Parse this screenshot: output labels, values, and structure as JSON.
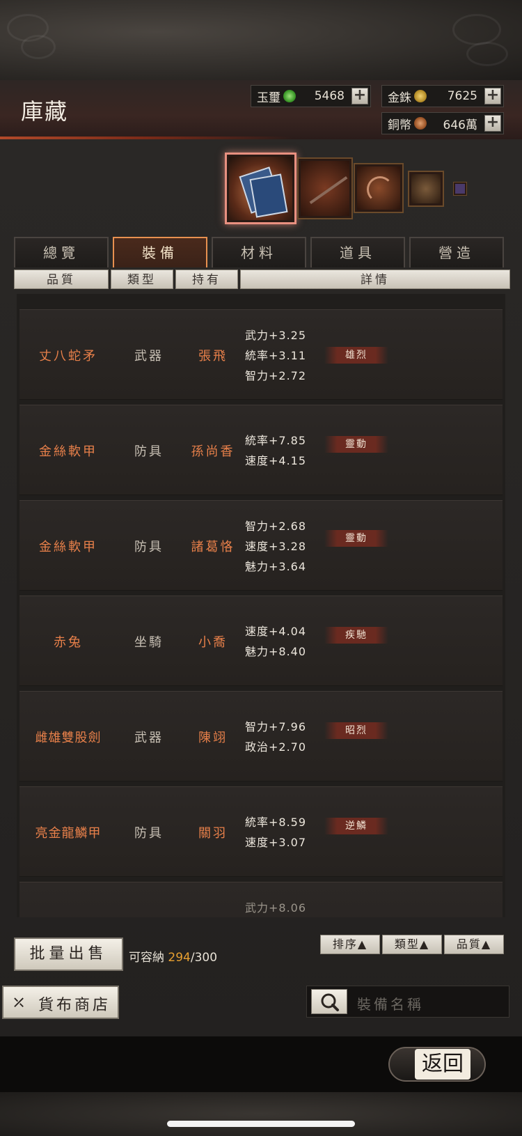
{
  "header": {
    "title": "庫藏",
    "resources": [
      {
        "label": "玉璽",
        "icon": "jade-coin-icon",
        "value": "5468"
      },
      {
        "label": "金銖",
        "icon": "gold-coin-icon",
        "value": "7625"
      },
      {
        "label": "銅幣",
        "icon": "copper-coin-icon",
        "value": "646萬"
      }
    ],
    "plus_label": "+"
  },
  "tabs": [
    {
      "label": "總覽",
      "active": false
    },
    {
      "label": "裝備",
      "active": true
    },
    {
      "label": "材料",
      "active": false
    },
    {
      "label": "道具",
      "active": false
    },
    {
      "label": "營造",
      "active": false
    }
  ],
  "columns": [
    "品質",
    "類型",
    "持有",
    "詳情"
  ],
  "items": [
    {
      "name": "丈八蛇矛",
      "type": "武器",
      "owner": "張飛",
      "stats": [
        "武力+3.25",
        "統率+3.11",
        "智力+2.72"
      ],
      "skill": "雄烈"
    },
    {
      "name": "金絲軟甲",
      "type": "防具",
      "owner": "孫尚香",
      "stats": [
        "統率+7.85",
        "速度+4.15"
      ],
      "skill": "靈動"
    },
    {
      "name": "金絲軟甲",
      "type": "防具",
      "owner": "諸葛恪",
      "stats": [
        "智力+2.68",
        "速度+3.28",
        "魅力+3.64"
      ],
      "skill": "靈動"
    },
    {
      "name": "赤兔",
      "type": "坐騎",
      "owner": "小喬",
      "stats": [
        "速度+4.04",
        "魅力+8.40"
      ],
      "skill": "疾馳"
    },
    {
      "name": "雌雄雙股劍",
      "type": "武器",
      "owner": "陳翊",
      "stats": [
        "智力+7.96",
        "政治+2.70"
      ],
      "skill": "昭烈"
    },
    {
      "name": "亮金龍鱗甲",
      "type": "防具",
      "owner": "關羽",
      "stats": [
        "統率+8.59",
        "速度+3.07"
      ],
      "skill": "逆鱗"
    },
    {
      "name": "",
      "type": "",
      "owner": "",
      "stats": [
        "武力+8.06"
      ],
      "skill": ""
    }
  ],
  "bottom": {
    "bulk_sell": "批量出售",
    "capacity_label": "可容納",
    "capacity_used": "294",
    "capacity_total": "/300",
    "sort_buttons": [
      "排序▲",
      "類型▲",
      "品質▲"
    ],
    "shop_button": "貨布商店",
    "search_placeholder": "裝備名稱",
    "return_button": "返回"
  }
}
